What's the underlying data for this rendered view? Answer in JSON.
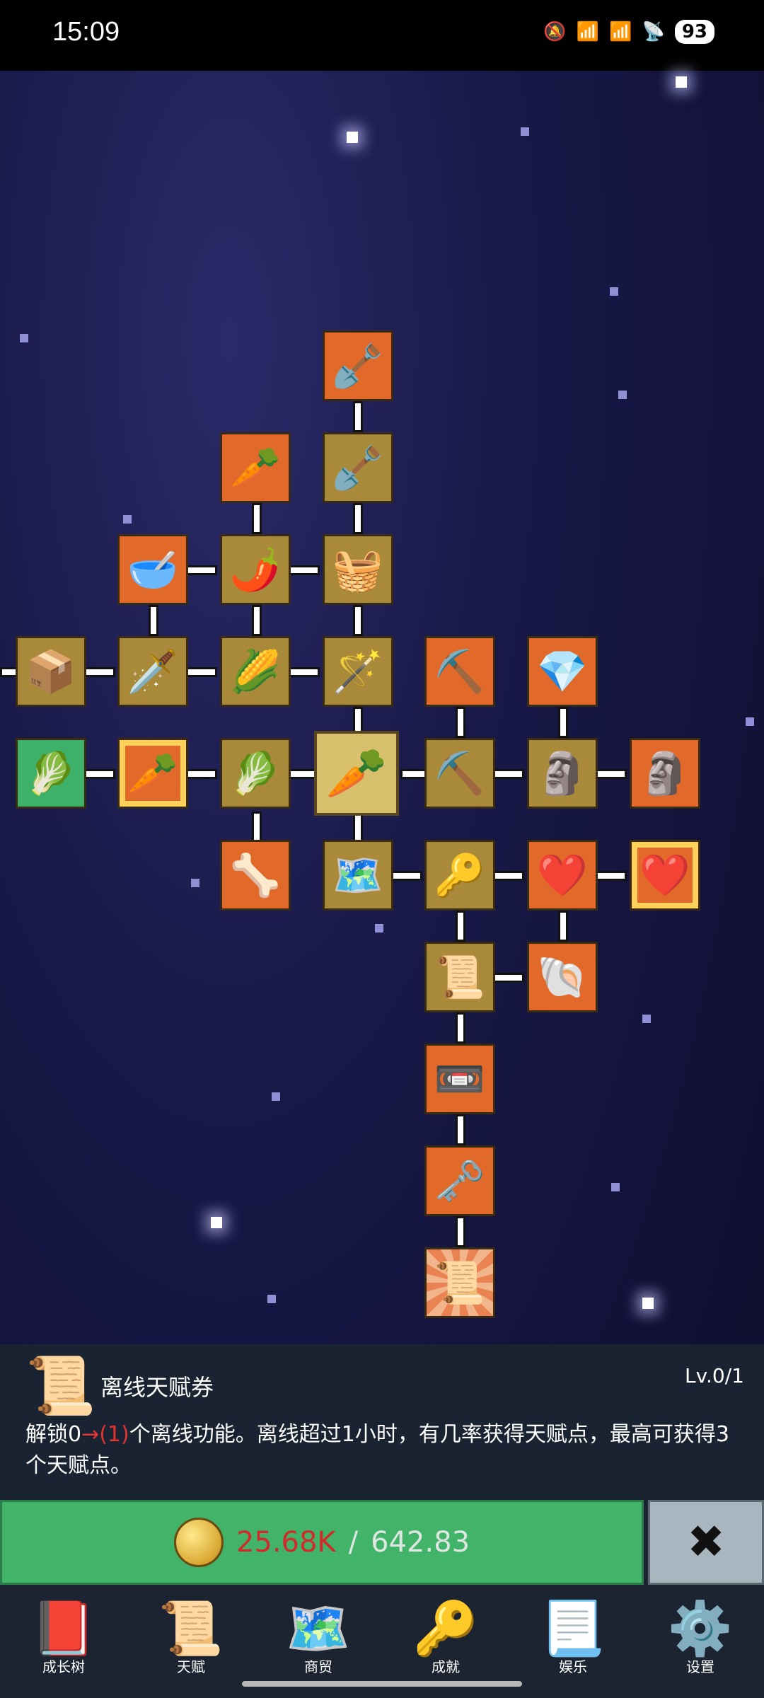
{
  "status": {
    "time": "15:09",
    "icons": [
      "mute-icon",
      "signal-4g-icon",
      "signal-4g-icon",
      "wifi-icon"
    ],
    "battery": "93"
  },
  "tree": {
    "nodes": [
      {
        "id": "shovel-up-2",
        "icon": "🪏",
        "color": "orange"
      },
      {
        "id": "radish",
        "icon": "🥕",
        "color": "orange"
      },
      {
        "id": "shovel-up-1",
        "icon": "🪏",
        "color": "olive"
      },
      {
        "id": "bowl",
        "icon": "🥣",
        "color": "orange"
      },
      {
        "id": "chili",
        "icon": "🌶️",
        "color": "olive"
      },
      {
        "id": "hay-bale",
        "icon": "🧺",
        "color": "olive"
      },
      {
        "id": "crate",
        "icon": "📦",
        "color": "olive"
      },
      {
        "id": "sword",
        "icon": "🗡️",
        "color": "olive"
      },
      {
        "id": "corn",
        "icon": "🌽",
        "color": "olive"
      },
      {
        "id": "wand",
        "icon": "🪄",
        "color": "olive"
      },
      {
        "id": "pickaxe-up",
        "icon": "⛏️",
        "color": "orange"
      },
      {
        "id": "crystal",
        "icon": "💎",
        "color": "orange"
      },
      {
        "id": "cabbage-up",
        "icon": "🥬",
        "color": "green"
      },
      {
        "id": "carrot-up",
        "icon": "🥕",
        "color": "glow"
      },
      {
        "id": "cabbage",
        "icon": "🥬",
        "color": "olive"
      },
      {
        "id": "carrot-center",
        "icon": "🥕",
        "color": "selected"
      },
      {
        "id": "pickaxe",
        "icon": "⛏️",
        "color": "olive"
      },
      {
        "id": "statue",
        "icon": "🗿",
        "color": "olive"
      },
      {
        "id": "statue-orange",
        "icon": "🗿",
        "color": "orange"
      },
      {
        "id": "bone",
        "icon": "🦴",
        "color": "orange"
      },
      {
        "id": "map",
        "icon": "🗺️",
        "color": "olive"
      },
      {
        "id": "gold-key",
        "icon": "🔑",
        "color": "olive"
      },
      {
        "id": "heart-up",
        "icon": "❤️",
        "color": "orange"
      },
      {
        "id": "heart-gold",
        "icon": "❤️",
        "color": "glow"
      },
      {
        "id": "scroll",
        "icon": "📜",
        "color": "olive"
      },
      {
        "id": "fossil",
        "icon": "🐚",
        "color": "orange"
      },
      {
        "id": "cassette",
        "icon": "📼",
        "color": "orange"
      },
      {
        "id": "iron-key",
        "icon": "🗝️",
        "color": "orange"
      },
      {
        "id": "offline-ticket",
        "icon": "📜",
        "color": "burst"
      }
    ]
  },
  "panel": {
    "title": "离线天赋券",
    "level": "Lv.0/1",
    "desc_prefix": "解锁0",
    "desc_arrow": "→(1)",
    "desc_suffix": "个离线功能。离线超过1小时，有几率获得天赋点，最高可获得3个天赋点。"
  },
  "purchase": {
    "have": "25.68K",
    "separator": " / ",
    "need": "642.83",
    "close": "✖"
  },
  "nav": [
    {
      "label": "成长树",
      "icon": "📕"
    },
    {
      "label": "天赋",
      "icon": "📜"
    },
    {
      "label": "商贸",
      "icon": "🗺️"
    },
    {
      "label": "成就",
      "icon": "🔑"
    },
    {
      "label": "娱乐",
      "icon": "📃"
    },
    {
      "label": "设置",
      "icon": "⚙️"
    }
  ]
}
